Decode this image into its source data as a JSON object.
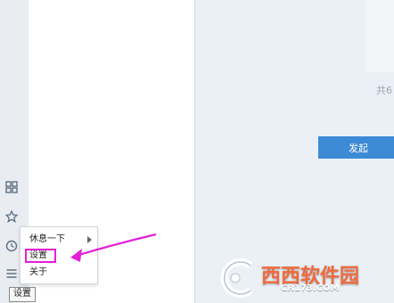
{
  "menu": {
    "items": [
      {
        "label": "休息一下",
        "has_submenu": true
      },
      {
        "label": "设置",
        "has_submenu": false
      },
      {
        "label": "关于",
        "has_submenu": false
      }
    ]
  },
  "tooltip": {
    "text": "设置"
  },
  "main": {
    "count_text": "共6",
    "send_button": "发起"
  },
  "watermark": {
    "brand_en": "CR",
    "brand_cn": "西西软件园",
    "url": "CR173.COM"
  },
  "rail_icons": [
    "grid-icon",
    "star-icon",
    "clock-icon",
    "menu-icon"
  ],
  "colors": {
    "highlight": "#e51fd8",
    "button": "#3d8ad6"
  }
}
